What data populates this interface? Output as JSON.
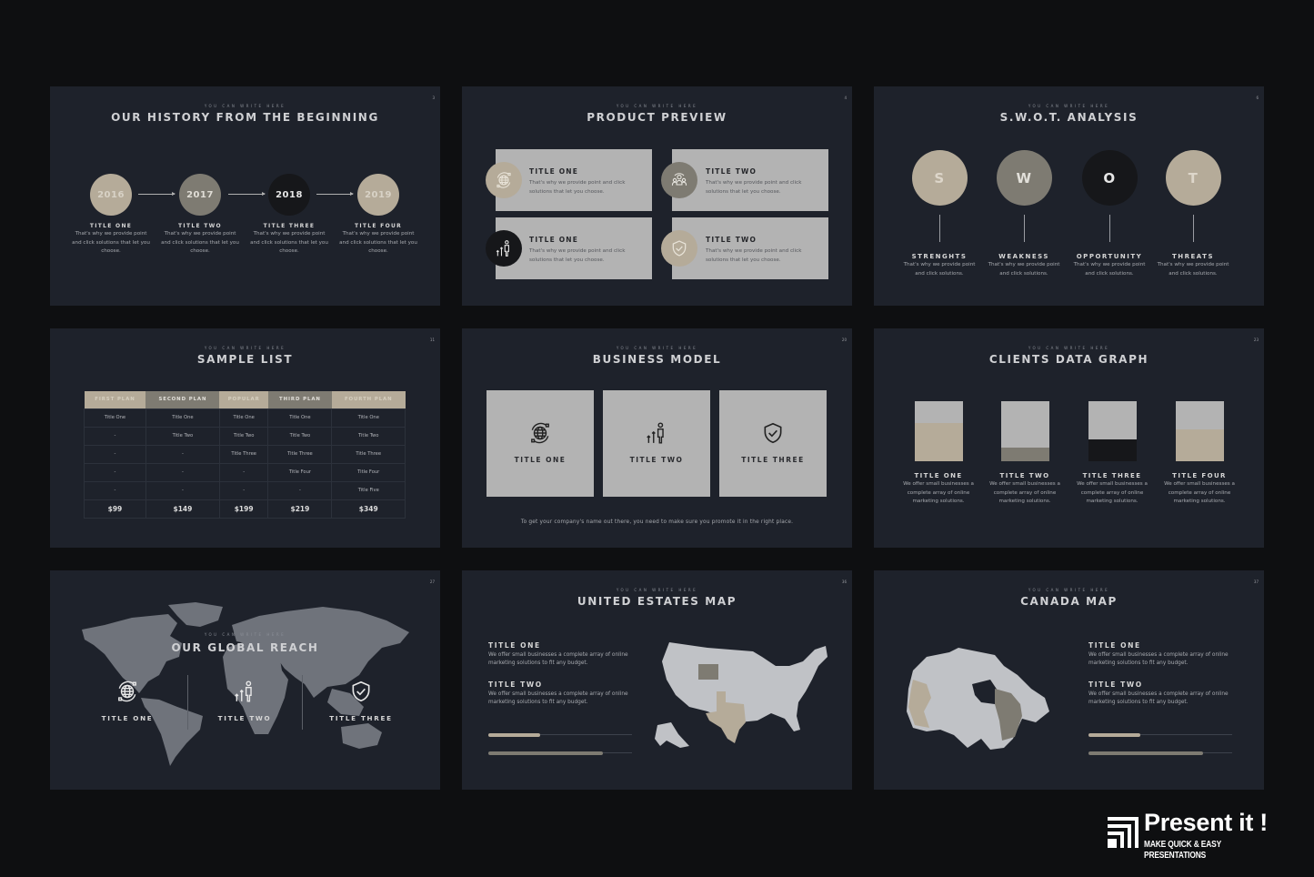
{
  "kicker": "YOU CAN WRITE HERE",
  "colors": {
    "background": "#0e0f11",
    "slide": "#1e222b",
    "tan": "#b5ab99",
    "grey": "#7e7b72",
    "black": "#16171a",
    "light": "#b3b3b3"
  },
  "slides": {
    "history": {
      "number": "3",
      "title": "OUR HISTORY FROM THE BEGINNING",
      "items": [
        {
          "year": "2016",
          "title": "TITLE ONE",
          "desc": "That's why we provide point and click solutions that let you choose."
        },
        {
          "year": "2017",
          "title": "TITLE TWO",
          "desc": "That's why we provide point and click solutions that let you choose."
        },
        {
          "year": "2018",
          "title": "TITLE THREE",
          "desc": "That's why we provide point and click solutions that let you choose."
        },
        {
          "year": "2019",
          "title": "TITLE FOUR",
          "desc": "That's why we provide point and click solutions that let you choose."
        }
      ]
    },
    "product": {
      "number": "4",
      "title": "PRODUCT PREVIEW",
      "cards": [
        {
          "title": "TITLE ONE",
          "desc": "That's why we provide point and click solutions that let you choose.",
          "icon": "globe-icon"
        },
        {
          "title": "TITLE TWO",
          "desc": "That's why we provide point and click solutions that let you choose.",
          "icon": "team-icon"
        },
        {
          "title": "TITLE ONE",
          "desc": "That's why we provide point and click solutions that let you choose.",
          "icon": "growth-person-icon"
        },
        {
          "title": "TITLE TWO",
          "desc": "That's why we provide point and click solutions that let you choose.",
          "icon": "shield-check-icon"
        }
      ]
    },
    "swot": {
      "number": "6",
      "title": "S.W.O.T. ANALYSIS",
      "items": [
        {
          "letter": "S",
          "title": "STRENGHTS",
          "desc": "That's why we provide point and click solutions."
        },
        {
          "letter": "W",
          "title": "WEAKNESS",
          "desc": "That's why we provide point and click solutions."
        },
        {
          "letter": "O",
          "title": "OPPORTUNITY",
          "desc": "That's why we provide point and click solutions."
        },
        {
          "letter": "T",
          "title": "THREATS",
          "desc": "That's why we provide point and click solutions."
        }
      ]
    },
    "sample_list": {
      "number": "11",
      "title": "SAMPLE LIST",
      "headers": [
        "FIRST PLAN",
        "SECOND PLAN",
        "POPULAR",
        "THIRD PLAN",
        "FOURTH PLAN"
      ],
      "rows": [
        [
          "Title One",
          "Title One",
          "Title One",
          "Title One",
          "Title One"
        ],
        [
          "-",
          "Title Two",
          "Title Two",
          "Title Two",
          "Title Two"
        ],
        [
          "-",
          "-",
          "Title Three",
          "Title Three",
          "Title Three"
        ],
        [
          "-",
          "-",
          "-",
          "Title Four",
          "Title Four"
        ],
        [
          "-",
          "-",
          "-",
          "-",
          "Title Five"
        ]
      ],
      "prices": [
        "$99",
        "$149",
        "$199",
        "$219",
        "$349"
      ]
    },
    "business": {
      "number": "20",
      "title": "BUSINESS MODEL",
      "cards": [
        {
          "title": "TITLE ONE",
          "icon": "globe-icon"
        },
        {
          "title": "TITLE TWO",
          "icon": "growth-person-icon"
        },
        {
          "title": "TITLE THREE",
          "icon": "shield-check-icon"
        }
      ],
      "footnote": "To get your company's name out there, you need to make sure you promote it in the right place."
    },
    "clients": {
      "number": "23",
      "title": "CLIENTS DATA GRAPH",
      "items": [
        {
          "title": "TITLE ONE",
          "desc": "We offer small businesses a complete array of online marketing solutions.",
          "fill": 0.64,
          "color": "tan"
        },
        {
          "title": "TITLE TWO",
          "desc": "We offer small businesses a complete array of online marketing solutions.",
          "fill": 0.23,
          "color": "grey"
        },
        {
          "title": "TITLE THREE",
          "desc": "We offer small businesses a complete array of online marketing solutions.",
          "fill": 0.36,
          "color": "black"
        },
        {
          "title": "TITLE FOUR",
          "desc": "We offer small businesses a complete array of online marketing solutions.",
          "fill": 0.53,
          "color": "tan"
        }
      ]
    },
    "global": {
      "number": "27",
      "title": "OUR GLOBAL REACH",
      "items": [
        {
          "title": "TITLE ONE",
          "icon": "globe-icon"
        },
        {
          "title": "TITLE TWO",
          "icon": "growth-person-icon"
        },
        {
          "title": "TITLE THREE",
          "icon": "shield-check-icon"
        }
      ]
    },
    "us_map": {
      "number": "36",
      "title": "UNITED ESTATES MAP",
      "items": [
        {
          "title": "TITLE ONE",
          "desc": "We offer small businesses a complete array of online marketing solutions to fit any budget."
        },
        {
          "title": "TITLE TWO",
          "desc": "We offer small businesses a complete array of online marketing solutions to fit any budget."
        }
      ],
      "progress": [
        0.36,
        0.8
      ]
    },
    "canada_map": {
      "number": "37",
      "title": "CANADA MAP",
      "items": [
        {
          "title": "TITLE ONE",
          "desc": "We offer small businesses a complete array of online marketing solutions to fit any budget."
        },
        {
          "title": "TITLE TWO",
          "desc": "We offer small businesses a complete array of online marketing solutions to fit any budget."
        }
      ],
      "progress": [
        0.36,
        0.8
      ]
    }
  },
  "brand": {
    "name": "Present it !",
    "tagline": "MAKE QUICK & EASY PRESENTATIONS"
  }
}
